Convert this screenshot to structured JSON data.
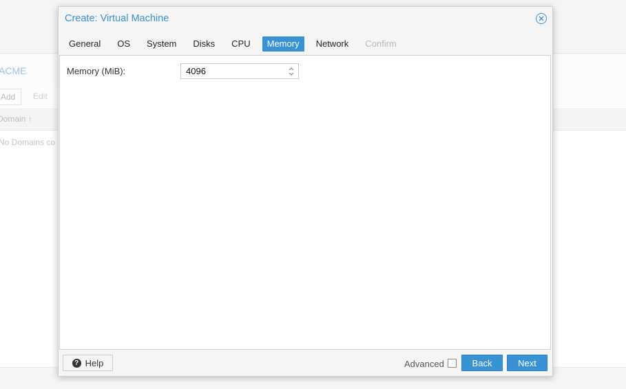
{
  "background": {
    "title": "ACME",
    "toolbar": {
      "add_label": "Add",
      "edit_label": "Edit"
    },
    "grid": {
      "column_domain": "Domain ↑",
      "empty_text": "No Domains co"
    }
  },
  "dialog": {
    "title": "Create: Virtual Machine",
    "tabs": [
      {
        "label": "General",
        "state": "normal"
      },
      {
        "label": "OS",
        "state": "normal"
      },
      {
        "label": "System",
        "state": "normal"
      },
      {
        "label": "Disks",
        "state": "normal"
      },
      {
        "label": "CPU",
        "state": "normal"
      },
      {
        "label": "Memory",
        "state": "active"
      },
      {
        "label": "Network",
        "state": "normal"
      },
      {
        "label": "Confirm",
        "state": "disabled"
      }
    ],
    "memory": {
      "label": "Memory (MiB):",
      "value": "4096"
    },
    "footer": {
      "help_label": "Help",
      "advanced_label": "Advanced",
      "advanced_checked": false,
      "back_label": "Back",
      "next_label": "Next"
    }
  },
  "colors": {
    "accent": "#3892d4",
    "panel_bg": "#ffffff",
    "dialog_bg": "#f5f5f5"
  },
  "icons": {
    "close": "close-circle-icon",
    "help": "question-circle-icon",
    "spinner": "spinner-arrows-icon",
    "sort": "sort-asc-icon"
  }
}
